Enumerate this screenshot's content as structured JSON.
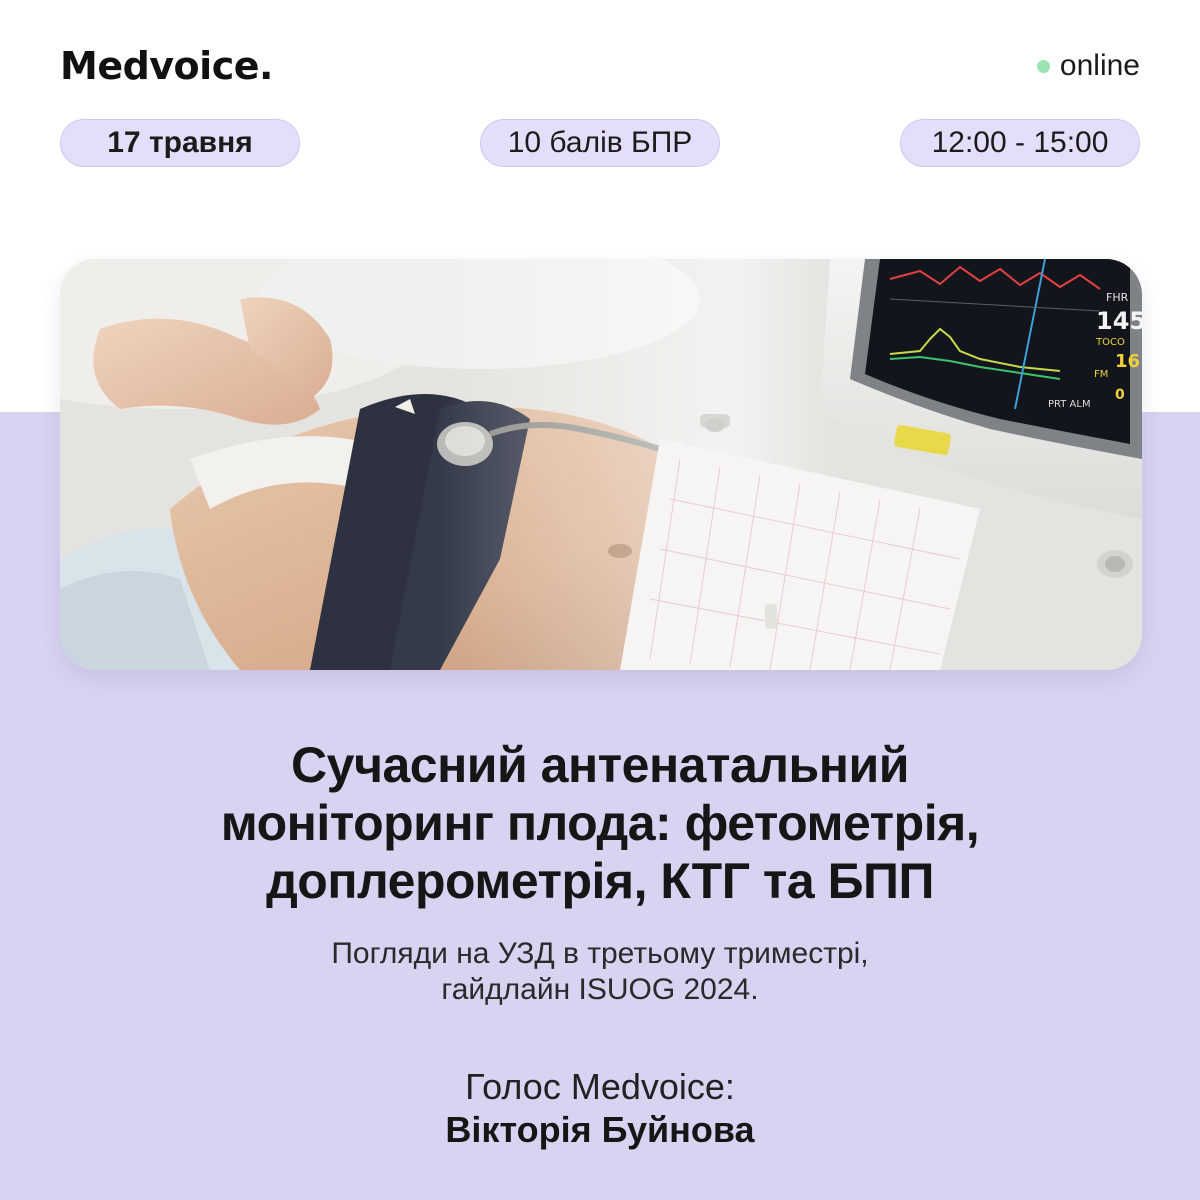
{
  "brand": {
    "logo_text": "Medvoice",
    "logo_dot": "."
  },
  "status": {
    "label": "online",
    "dot_color": "#9be3b0"
  },
  "pills": {
    "date": "17 травня",
    "points": "10 балів БПР",
    "time": "12:00 - 15:00"
  },
  "image": {
    "icon": "ctg-monitoring-photo",
    "monitor_readouts": {
      "fhr_label": "FHR",
      "fhr_value": "145",
      "toco_label": "TOCO",
      "toco_value": "16",
      "fm_label": "FM",
      "alm_label": "PRT ALM",
      "alm_value": "0"
    }
  },
  "title_lines": [
    "Сучасний антенатальний",
    "моніторинг плода: фетометрія,",
    "доплерометрія, КТГ та БПП"
  ],
  "subtitle_lines": [
    "Погляди на УЗД в третьому триместрі,",
    "гайдлайн ISUOG 2024."
  ],
  "speaker": {
    "label": "Голос Medvoice:",
    "name": "Вікторія Буйнова"
  },
  "colors": {
    "background": "#ffffff",
    "lilac_band": "#d9d2f1",
    "pill_fill": "#e4defa",
    "accent_green": "#8fd9a8",
    "text": "#161616"
  }
}
